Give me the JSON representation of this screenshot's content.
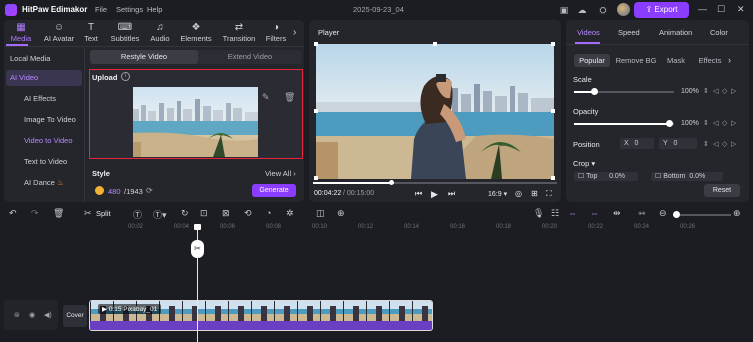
{
  "app": {
    "name": "HitPaw Edimakor",
    "date": "2025-09-23_04",
    "export_label": "Export"
  },
  "menu": [
    "File",
    "Settings",
    "Help"
  ],
  "top_tabs": [
    {
      "label": "Media",
      "icon": "media-icon"
    },
    {
      "label": "AI Avatar",
      "icon": "ai-avatar-icon"
    },
    {
      "label": "Text",
      "icon": "text-icon"
    },
    {
      "label": "Subtitles",
      "icon": "subtitles-icon"
    },
    {
      "label": "Audio",
      "icon": "audio-icon"
    },
    {
      "label": "Elements",
      "icon": "elements-icon"
    },
    {
      "label": "Transition",
      "icon": "transition-icon"
    },
    {
      "label": "Filters",
      "icon": "filters-icon"
    }
  ],
  "sidebar": {
    "items": [
      "Local Media",
      "AI Video",
      "AI Effects",
      "Image To Video",
      "Video to Video",
      "Text to Video",
      "AI Dance"
    ]
  },
  "ai_video": {
    "restyle_tab": "Restyle Video",
    "extend_tab": "Extend Video",
    "upload_label": "Upload",
    "style_label": "Style",
    "view_all": "View All",
    "credits_used": "480",
    "credits_total": "/1943",
    "generate_label": "Generate"
  },
  "player": {
    "label": "Player",
    "time_current": "00:04:22",
    "time_total": "/ 00:15:00",
    "aspect": "16:9",
    "progress": 0.29
  },
  "properties": {
    "tabs": [
      "Videos",
      "Speed",
      "Animation",
      "Color"
    ],
    "subtabs": [
      "Popular",
      "Remove BG",
      "Mask",
      "Effects"
    ],
    "scale_label": "Scale",
    "scale_value": "100%",
    "opacity_label": "Opacity",
    "opacity_value": "100%",
    "position_label": "Position",
    "x_label": "X",
    "x_value": "0",
    "y_label": "Y",
    "y_value": "0",
    "crop_label": "Crop",
    "top_label": "Top",
    "top_value": "0.0%",
    "bottom_label": "Bottom",
    "bottom_value": "0.0%",
    "reset_label": "Reset"
  },
  "toolbar": {
    "split_label": "Split"
  },
  "timeline": {
    "ticks": [
      "00:02",
      "00:04",
      "00:06",
      "00:08",
      "00:10",
      "00:12",
      "00:14",
      "00:16",
      "00:18",
      "00:20",
      "00:22",
      "00:24",
      "00:26"
    ],
    "cover_label": "Cover",
    "clip_label": "0:15 Pixabay_01"
  }
}
